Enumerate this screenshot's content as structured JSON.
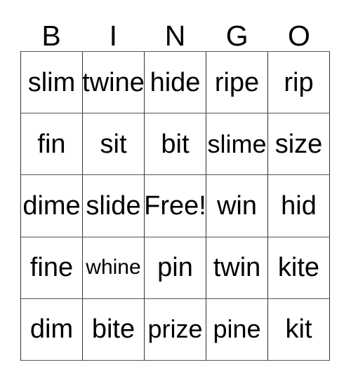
{
  "card": {
    "title": "BINGO",
    "free_space_label": "Free!",
    "text_color": "#000000",
    "grid_line_color": "#333333",
    "background_color": "#ffffff",
    "headers": [
      "B",
      "I",
      "N",
      "G",
      "O"
    ],
    "rows": [
      [
        "slim",
        "twine",
        "hide",
        "ripe",
        "rip"
      ],
      [
        "fin",
        "sit",
        "bit",
        "slime",
        "size"
      ],
      [
        "dime",
        "slide",
        "Free!",
        "win",
        "hid"
      ],
      [
        "fine",
        "whine",
        "pin",
        "twin",
        "kite"
      ],
      [
        "dim",
        "bite",
        "prize",
        "pine",
        "kit"
      ]
    ]
  }
}
